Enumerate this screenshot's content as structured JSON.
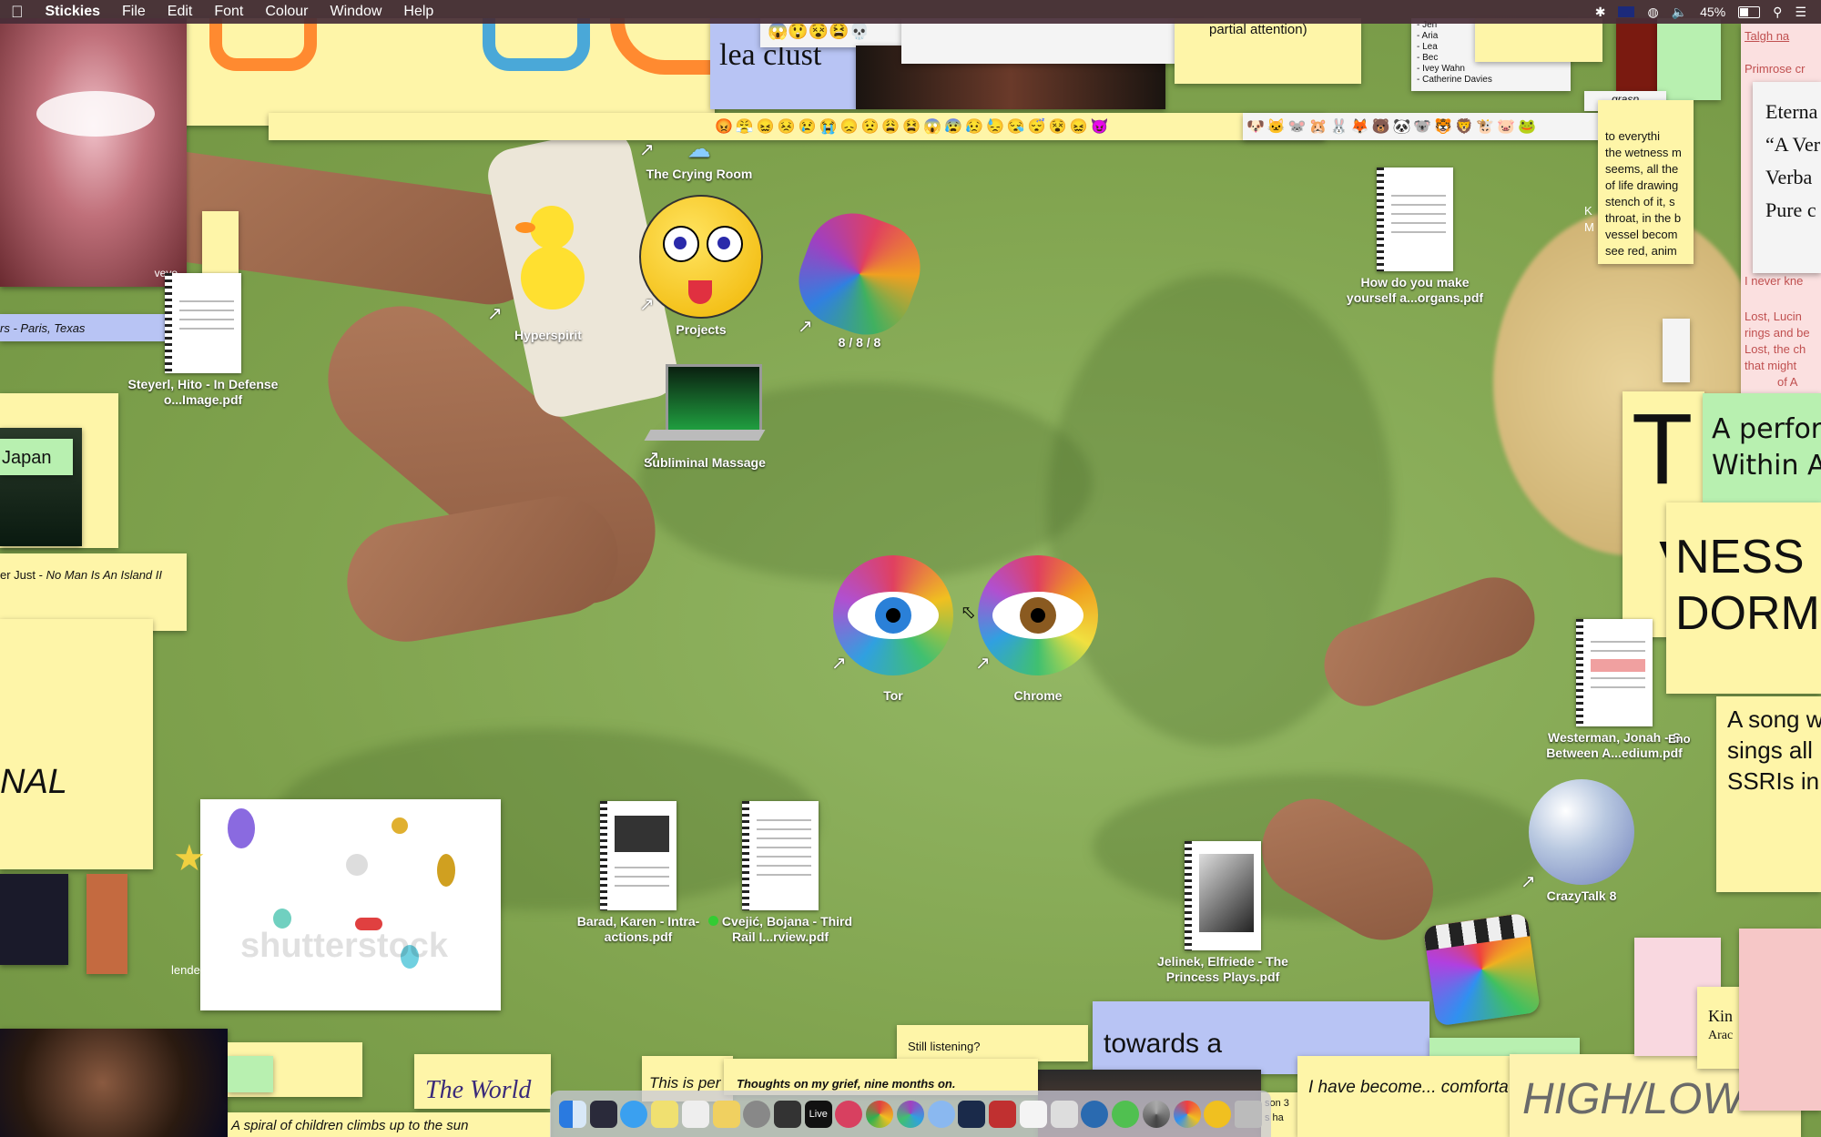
{
  "menubar": {
    "app_name": "Stickies",
    "items": [
      "File",
      "Edit",
      "Font",
      "Colour",
      "Window",
      "Help"
    ],
    "battery": "45%"
  },
  "icons": {
    "crying_room": "The Crying Room",
    "hyperspirit": "Hyperspirit",
    "projects": "Projects",
    "eight": "8 / 8 / 8",
    "how_do_you": "How do you make yourself a...organs.pdf",
    "steyerl": "Steyerl, Hito - In Defense o...Image.pdf",
    "subliminal": "Subliminal Massage",
    "tor": "Tor",
    "chrome": "Chrome",
    "westerman": "Westerman, Jonah - S Between A...edium.pdf",
    "crazytalk": "CrazyTalk 8",
    "barad": "Barad, Karen - Intra-actions.pdf",
    "cvejic": "Cvejić, Bojana - Third Rail I...rview.pdf",
    "jelinek": "Jelinek, Elfriede - The Princess Plays.pdf"
  },
  "stickies": {
    "paris_texas": "rs - Paris, Texas",
    "japan": "Japan",
    "just_prefix": "er Just - ",
    "just_title": "No Man Is An Island II",
    "nal": "NAL",
    "lea_clust": "lea clust",
    "partial_attention": "partial attention)",
    "names": [
      "- Jen",
      "- Aria",
      "- Lea",
      "- Bec",
      "- Ivey Wahn",
      "- Catherine Davies"
    ],
    "grasp": "grasp.",
    "wetness": [
      "to everythi",
      "the wetness m",
      "seems, all the",
      "of life drawing",
      "stench of it, s",
      "throat, in the b",
      "vessel becom",
      "see red, anim"
    ],
    "talgh": "Talgh na",
    "primrose": "Primrose cr",
    "eterna": [
      "Eterna",
      "“A Ver",
      "Verba",
      "Pure c"
    ],
    "lost_lines": [
      "I never kne",
      "Lost, Lucin",
      "rings and be",
      "Lost, the ch",
      "that might",
      "of A"
    ],
    "perform": [
      "A perfor",
      "Within A"
    ],
    "big_t": "T",
    "big_v": "V",
    "ness": [
      "NESS",
      "DORM"
    ],
    "song": [
      "A song w",
      "sings all",
      "SSRIs in"
    ],
    "eno": "Eno",
    "km": [
      "K",
      "M"
    ],
    "kin": [
      "Kin",
      "Arac"
    ],
    "the_world": "The World",
    "spiral": "A spiral of children climbs up to the sun",
    "this_is_per": "This is per",
    "still_listening": "Still listening?",
    "towards_a": "towards a",
    "thoughts": "Thoughts on my grief, nine months on.",
    "i_have_become": "I have become... comforta",
    "high_low": "HIGH/LOW",
    "son": [
      "son 3",
      "s ha"
    ],
    "blender": "lende",
    "vevo": "vevo",
    "shutterstock": "shutterstock"
  },
  "colors": {
    "sticky_yellow": "#fef5a8",
    "sticky_blue": "#b8c4f4",
    "sticky_green": "#b8f0b0",
    "sticky_pink": "#f6c7c7",
    "menubar": "#462d37"
  },
  "dock": {
    "apps": [
      "finder-icon",
      "mission-control-icon",
      "messages-icon",
      "stickies-icon",
      "preview-icon",
      "notes-icon",
      "system-preferences-icon",
      "final-cut-icon",
      "live-icon",
      "eye-icon",
      "chrome-icon",
      "tor-icon",
      "safari-icon",
      "screen-icon",
      "photo-booth-icon",
      "textedit-icon",
      "script-icon",
      "proxy-icon",
      "creative-cloud-icon",
      "spiral-icon",
      "pinwheel-icon",
      "smiley-icon",
      "trash-icon"
    ],
    "live_label": "Live"
  }
}
